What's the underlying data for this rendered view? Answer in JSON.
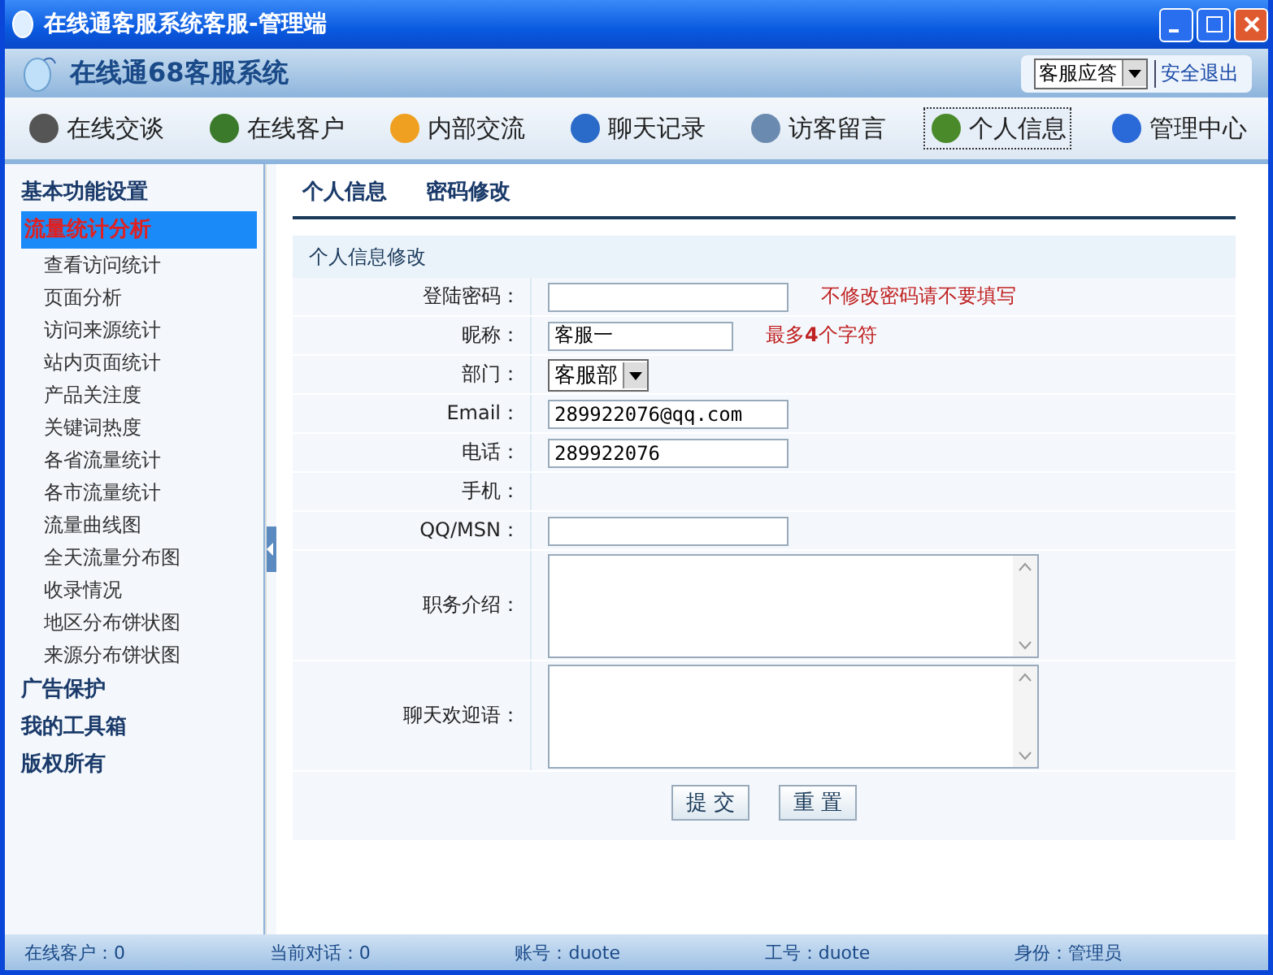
{
  "window": {
    "title": "在线通客服系统客服-管理端"
  },
  "header": {
    "title": "在线通68客服系统",
    "status_select": "客服应答",
    "logout": "安全退出"
  },
  "nav": [
    {
      "label": "在线交谈",
      "selected": false
    },
    {
      "label": "在线客户",
      "selected": false
    },
    {
      "label": "内部交流",
      "selected": false
    },
    {
      "label": "聊天记录",
      "selected": false
    },
    {
      "label": "访客留言",
      "selected": false
    },
    {
      "label": "个人信息",
      "selected": true
    },
    {
      "label": "管理中心",
      "selected": false
    }
  ],
  "sidebar": {
    "items": [
      {
        "label": "基本功能设置",
        "selected": false
      },
      {
        "label": "流量统计分析",
        "selected": true,
        "children": [
          "查看访问统计",
          "页面分析",
          "访问来源统计",
          "站内页面统计",
          "产品关注度",
          "关键词热度",
          "各省流量统计",
          "各市流量统计",
          "流量曲线图",
          "全天流量分布图",
          "收录情况",
          "地区分布饼状图",
          "来源分布饼状图"
        ]
      },
      {
        "label": "广告保护",
        "selected": false
      },
      {
        "label": "我的工具箱",
        "selected": false
      },
      {
        "label": "版权所有",
        "selected": false
      }
    ]
  },
  "tabs": [
    "个人信息",
    "密码修改"
  ],
  "form": {
    "title": "个人信息修改",
    "rows": [
      {
        "kind": "text",
        "label": "登陆密码：",
        "hint": "不修改密码请不要填写"
      },
      {
        "kind": "short_text",
        "label": "昵称：",
        "value": "客服一",
        "hint": "最多**4**个字符"
      },
      {
        "kind": "select",
        "label": "部门：",
        "value": "客服部"
      },
      {
        "kind": "text",
        "label": "Email：",
        "value": "289922076@qq.com"
      },
      {
        "kind": "text",
        "label": "电话：",
        "value": "289922076"
      },
      {
        "kind": "none",
        "label": "手机："
      },
      {
        "kind": "text",
        "label": "QQ/MSN："
      },
      {
        "kind": "textarea",
        "label": "职务介绍："
      },
      {
        "kind": "textarea",
        "label": "聊天欢迎语："
      }
    ],
    "buttons": [
      "提 交",
      "重 置"
    ]
  },
  "status_bar": [
    "在线客户：0",
    "当前对话：0",
    "账号：duote",
    "工号：duote",
    "身份：管理员"
  ]
}
